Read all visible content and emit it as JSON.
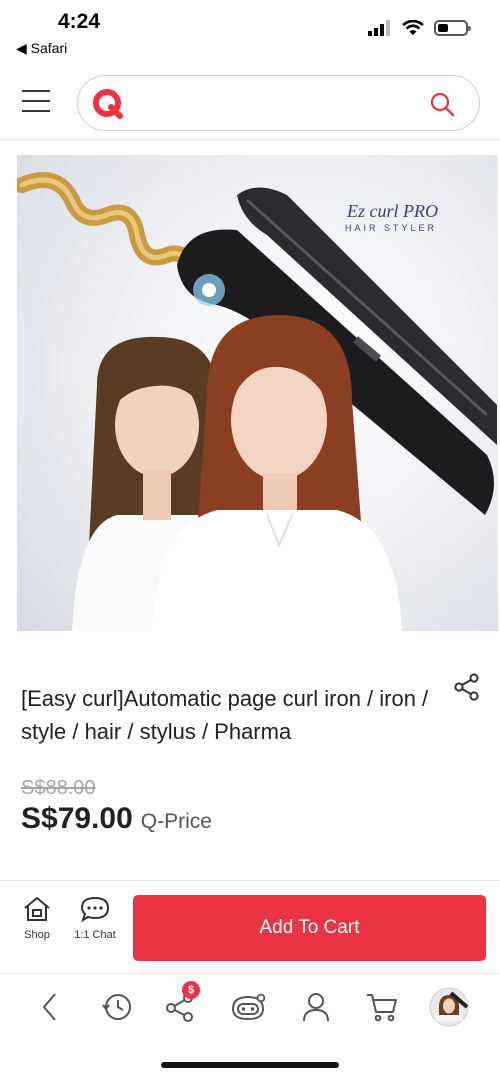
{
  "status_bar": {
    "time": "4:24",
    "back_app": "◀ Safari"
  },
  "header": {
    "logo_icon": "q-logo-icon",
    "search_placeholder": "",
    "accent_color": "#ec3343"
  },
  "product": {
    "image_brand_text": "Ez curl PRO",
    "image_tagline": "HAIR STYLER",
    "title": "[Easy curl]Automatic page curl iron / iron / style / hair / stylus / Pharma",
    "original_price": "S$88.00",
    "price": "S$79.00",
    "price_label": "Q-Price"
  },
  "action_bar": {
    "shop_label": "Shop",
    "chat_label": "1:1 Chat",
    "add_to_cart_label": "Add To Cart",
    "button_color": "#ec3343"
  },
  "bottom_nav": {
    "items": [
      {
        "icon": "back-arrow-icon"
      },
      {
        "icon": "history-icon"
      },
      {
        "icon": "share-network-icon",
        "badge": "$"
      },
      {
        "icon": "q-robot-icon"
      },
      {
        "icon": "user-icon"
      },
      {
        "icon": "cart-icon"
      },
      {
        "icon": "profile-avatar-icon"
      }
    ]
  }
}
